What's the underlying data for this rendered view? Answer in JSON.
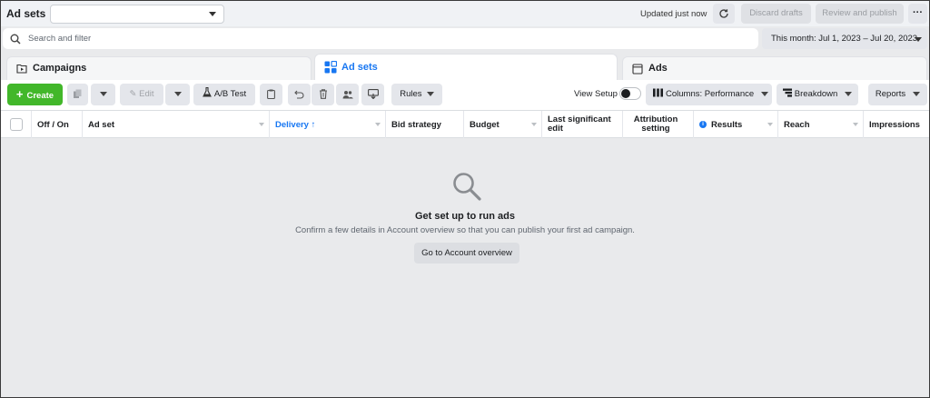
{
  "header": {
    "title": "Ad sets",
    "selector_value": "",
    "updated_text": "Updated just now",
    "refresh_icon": "refresh-icon",
    "discard_label": "Discard drafts",
    "review_label": "Review and publish",
    "more_label": "···"
  },
  "search": {
    "placeholder": "Search and filter",
    "value": "",
    "date_range": "This month: Jul 1, 2023 – Jul 20, 2023"
  },
  "tabs": [
    {
      "label": "Campaigns",
      "icon": "campaign-folder-icon",
      "active": false
    },
    {
      "label": "Ad sets",
      "icon": "grid-icon",
      "active": true
    },
    {
      "label": "Ads",
      "icon": "ad-page-icon",
      "active": false
    }
  ],
  "toolbar": {
    "create_label": "Create",
    "edit_label": "Edit",
    "ab_test_label": "A/B Test",
    "rules_label": "Rules",
    "view_setup_label": "View Setup",
    "view_setup_on": false,
    "columns_label": "Columns: Performance",
    "breakdown_label": "Breakdown",
    "reports_label": "Reports"
  },
  "table": {
    "columns": [
      "Off / On",
      "Ad set",
      "Delivery ↑",
      "Bid strategy",
      "Budget",
      "Last significant edit",
      "Attribution setting",
      "Results",
      "Reach",
      "Impressions"
    ]
  },
  "empty_state": {
    "icon": "magnifier-icon",
    "title": "Get set up to run ads",
    "subtitle": "Confirm a few details in Account overview so that you can publish your first ad campaign.",
    "button_label": "Go to Account overview"
  },
  "colors": {
    "accent": "#1877f2",
    "create_green": "#42b72a",
    "background": "#e9eaec"
  }
}
